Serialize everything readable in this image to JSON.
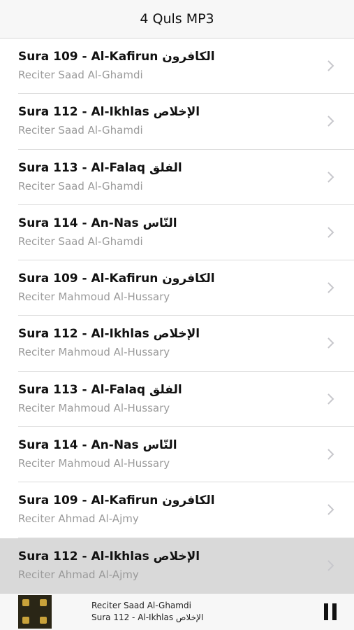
{
  "navbar": {
    "title": "4 Quls MP3"
  },
  "rows": [
    {
      "title": "Sura 109 - Al-Kafirun الكافرون",
      "subtitle": "Reciter Saad Al-Ghamdi"
    },
    {
      "title": "Sura 112 - Al-Ikhlas الإخلاص",
      "subtitle": "Reciter Saad Al-Ghamdi"
    },
    {
      "title": "Sura 113 - Al-Falaq الفلق",
      "subtitle": "Reciter Saad Al-Ghamdi"
    },
    {
      "title": "Sura 114 - An-Nas النّاس",
      "subtitle": "Reciter Saad Al-Ghamdi"
    },
    {
      "title": "Sura 109 - Al-Kafirun الكافرون",
      "subtitle": "Reciter Mahmoud Al-Hussary"
    },
    {
      "title": "Sura 112 - Al-Ikhlas الإخلاص",
      "subtitle": "Reciter Mahmoud Al-Hussary"
    },
    {
      "title": "Sura 113 - Al-Falaq الفلق",
      "subtitle": "Reciter Mahmoud Al-Hussary"
    },
    {
      "title": "Sura 114 - An-Nas النّاس",
      "subtitle": "Reciter Mahmoud Al-Hussary"
    },
    {
      "title": "Sura 109 - Al-Kafirun الكافرون",
      "subtitle": "Reciter Ahmad Al-Ajmy"
    },
    {
      "title": "Sura 112 - Al-Ikhlas الإخلاص",
      "subtitle": "Reciter Ahmad Al-Ajmy",
      "selected": true
    }
  ],
  "player": {
    "reciter": "Reciter Saad Al-Ghamdi",
    "track": "Sura 112 - Al-Ikhlas الإخلاص",
    "artwork_icon": "album-artwork",
    "control_icon": "pause-icon"
  },
  "colors": {
    "highlight": "#d9d9d9",
    "subtitle": "#9a9a9a",
    "chevron": "#c7c7cc"
  }
}
